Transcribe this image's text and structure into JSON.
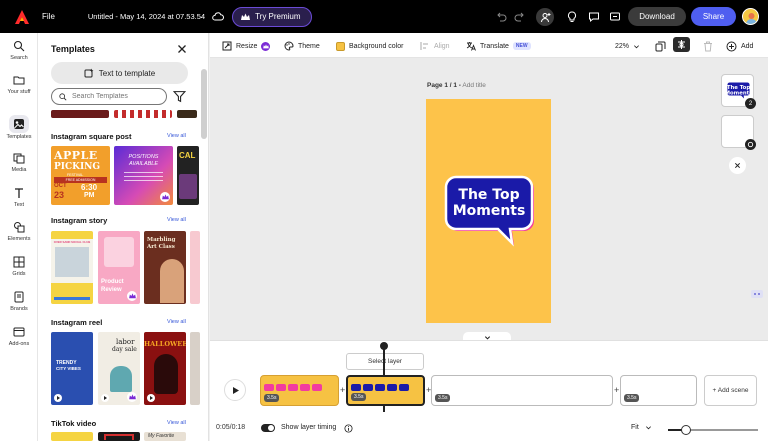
{
  "header": {
    "file_label": "File",
    "doc_title": "Untitled - May 14, 2024 at 07.53.54",
    "try_premium": "Try Premium",
    "download": "Download",
    "share": "Share"
  },
  "rail": {
    "items": [
      {
        "label": "Search",
        "icon": "search-icon"
      },
      {
        "label": "Your stuff",
        "icon": "folder-icon"
      },
      {
        "label": "Templates",
        "icon": "templates-icon"
      },
      {
        "label": "Media",
        "icon": "media-icon"
      },
      {
        "label": "Text",
        "icon": "text-icon"
      },
      {
        "label": "Elements",
        "icon": "elements-icon"
      },
      {
        "label": "Grids",
        "icon": "grids-icon"
      },
      {
        "label": "Brands",
        "icon": "brands-icon"
      },
      {
        "label": "Add-ons",
        "icon": "addons-icon"
      }
    ]
  },
  "panel": {
    "title": "Templates",
    "text_to_template": "Text to template",
    "search_placeholder": "Search Templates",
    "sections": [
      {
        "title": "Instagram square post",
        "view_all": "View all"
      },
      {
        "title": "Instagram story",
        "view_all": "View all"
      },
      {
        "title": "Instagram reel",
        "view_all": "View all"
      },
      {
        "title": "TikTok video",
        "view_all": "View all"
      }
    ],
    "square_thumbs": [
      {
        "line1": "APPLE",
        "line2": "PICKING",
        "line3": "FESTIVAL",
        "line4": "FREE ADMISSION",
        "date": "OCT",
        "day": "23",
        "time": "6:30",
        "ampm": "PM"
      },
      {
        "line1": "POSITIONS",
        "line2": "AVAILABLE"
      },
      {
        "line1": "CAL"
      }
    ],
    "story_thumbs": [
      {
        "line1": "OVER SAND SOCIAL CLUB"
      },
      {
        "line1": "Product",
        "line2": "Review"
      },
      {
        "line1": "Marbling",
        "line2": "Art Class"
      }
    ],
    "reel_thumbs": [
      {
        "line1": "TRENDY",
        "line2": "CITY VIBES"
      },
      {
        "line1": "labor",
        "line2": "day sale"
      },
      {
        "line1": "HALLOWEEN"
      }
    ],
    "tiktok_thumbs": [
      {
        "line1": ""
      },
      {
        "line1": ""
      },
      {
        "line1": "My Favorite"
      }
    ]
  },
  "toolbar": {
    "resize": "Resize",
    "theme": "Theme",
    "background_color": "Background color",
    "align": "Align",
    "translate": "Translate",
    "new_badge": "NEW",
    "zoom": "22%",
    "add": "Add"
  },
  "canvas": {
    "page_label": "Page 1 / 1 -",
    "add_title": "Add title",
    "headline_line1": "The Top",
    "headline_line2": "Moments",
    "side_thumb_badge": "2",
    "colors": {
      "page_bg": "#fdc34a",
      "bubble": "#1a1aa8",
      "accent": "#f23ca0"
    }
  },
  "timeline": {
    "select_layer": "Select layer",
    "scenes": [
      {
        "time": "3.5s"
      },
      {
        "time": "3.5s"
      },
      {
        "time": "3.5s"
      },
      {
        "time": "3.5s"
      }
    ],
    "add_scene": "+ Add scene",
    "time_readout": "0:05/0:18",
    "show_layer_timing": "Show layer timing",
    "fit": "Fit",
    "zoom_level": 0.2
  }
}
